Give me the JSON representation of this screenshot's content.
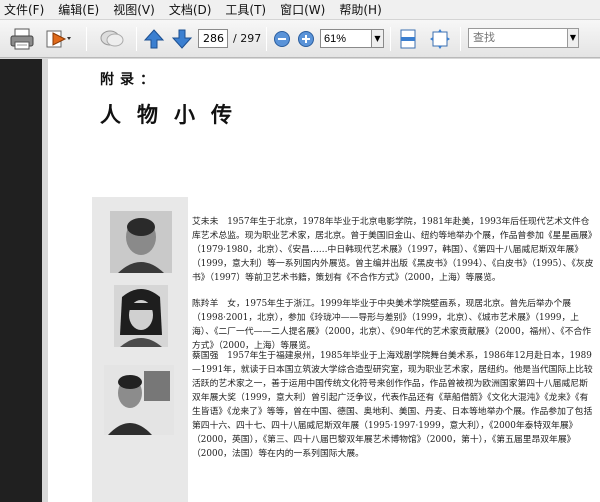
{
  "menu": {
    "items": [
      "文件(F)",
      "编辑(E)",
      "视图(V)",
      "文档(D)",
      "工具(T)",
      "窗口(W)",
      "帮助(H)"
    ]
  },
  "toolbar": {
    "current_page": "286",
    "total_pages": "/ 297",
    "zoom": "61%",
    "search_placeholder": "查找"
  },
  "document": {
    "appendix": "附录：",
    "title": "人物小传",
    "bios": [
      {
        "name": "艾未未",
        "text": "艾未未　1957年生于北京，1978年毕业于北京电影学院，1981年赴美，1993年后任现代艺术文件仓库艺术总监。现为职业艺术家，居北京。曾于美国旧金山、纽约等地举办个展，作品曾参加《星星画展》（1979·1980，北京）、《安昌……中日韩现代艺术展》（1997，韩国）、《第四十八届威尼斯双年展》（1999，意大利）等一系列国内外展览。曾主编并出版《黑皮书》（1994）、《白皮书》（1995）、《灰皮书》（1997）等前卫艺术书籍，策划有《不合作方式》（2000，上海）等展览。"
      },
      {
        "name": "陈羚羊",
        "text": "陈羚羊　女，1975年生于浙江。1999年毕业于中央美术学院壁画系，现居北京。曾先后举办个展（1998·2001，北京），参加《玲珑冲——导形与差别》（1999，北京）、《城市艺术展》（1999，上海）、《二厂一代——二人提名展》（2000，北京）、《90年代的艺术家贡献展》（2000，福州）、《不合作方式》（2000，上海）等展览。"
      },
      {
        "name": "蔡国强",
        "text": "蔡国强　1957年生于福建泉州，1985年毕业于上海戏剧学院舞台美术系，1986年12月赴日本，1989—1991年，就读于日本国立筑波大学综合造型研究室，现为职业艺术家，居纽约。他是当代国际上比较活跃的艺术家之一，善于运用中国传统文化符号来创作作品，作品曾被视为欧洲国家第四十八届威尼斯双年展大奖（1999，意大利）曾引起广泛争议，代表作品还有《草船借箭》《文化大混沌》《龙来》《有生皆语》《龙来了》等等，曾在中国、德国、奥地利、美国、丹麦、日本等地举办个展。作品参加了包括第四十六、四十七、四十八届威尼斯双年展（1995·1997·1999，意大利），《2000年泰特双年展》（2000，英国），《第三、四十八届巴黎双年展艺术博物馆》（2000，第十），《第五届里昂双年展》（2000，法国）等在内的一系列国际大展。"
      }
    ]
  },
  "icons": {
    "print": "printer-icon",
    "send": "send-icon",
    "comment": "comment-icon",
    "page_up": "arrow-up-icon",
    "page_down": "arrow-down-icon",
    "zoom_out": "zoom-out-icon",
    "zoom_in": "zoom-in-icon",
    "fit_page": "fit-page-icon",
    "fit_width": "fit-width-icon"
  }
}
